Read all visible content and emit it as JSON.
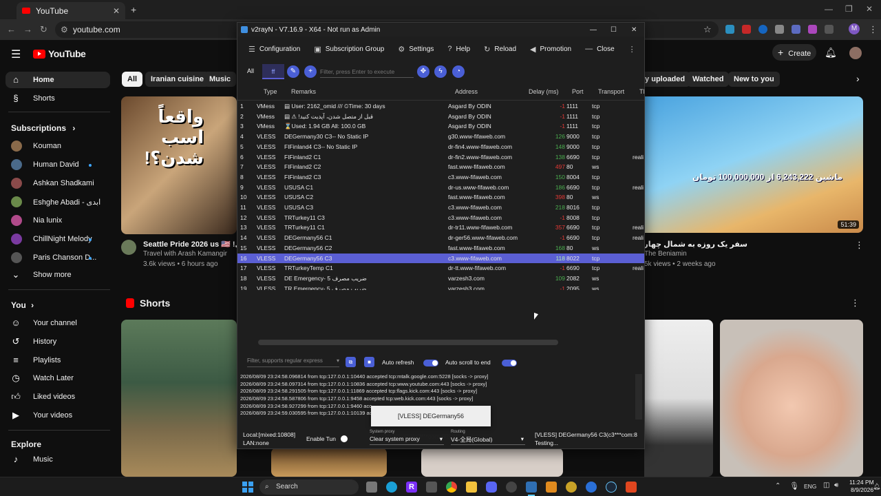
{
  "browser": {
    "tab_title": "YouTube",
    "url": "youtube.com",
    "profile_initial": "M"
  },
  "youtube": {
    "logo": "YouTube",
    "create_label": "Create",
    "nav": [
      {
        "label": "Home",
        "icon": "home-icon"
      },
      {
        "label": "Shorts",
        "icon": "shorts-icon"
      }
    ],
    "subscriptions_title": "Subscriptions",
    "subscriptions": [
      {
        "name": "Kouman",
        "dot": false,
        "color": "#8a6a4a"
      },
      {
        "name": "Human David",
        "dot": true,
        "color": "#4a6a8a"
      },
      {
        "name": "Ashkan Shadkami",
        "dot": false,
        "color": "#8a4a4a"
      },
      {
        "name": "Eshghe Abadi - ابدی",
        "dot": false,
        "color": "#6a8a4a"
      },
      {
        "name": "Nia lunix",
        "dot": false,
        "color": "#b04a8a"
      },
      {
        "name": "ChillNight Melody",
        "dot": true,
        "color": "#7a3aa0"
      },
      {
        "name": "Paris Chanson D...",
        "dot": true,
        "color": "#555555"
      }
    ],
    "show_more": "Show more",
    "you_title": "You",
    "you_items": [
      {
        "label": "Your channel",
        "icon": "channel-icon"
      },
      {
        "label": "History",
        "icon": "history-icon"
      },
      {
        "label": "Playlists",
        "icon": "playlists-icon"
      },
      {
        "label": "Watch Later",
        "icon": "watch-later-icon"
      },
      {
        "label": "Liked videos",
        "icon": "like-icon"
      },
      {
        "label": "Your videos",
        "icon": "your-videos-icon"
      }
    ],
    "explore_title": "Explore",
    "explore_items": [
      {
        "label": "Music",
        "icon": "music-icon"
      }
    ],
    "chips_left": [
      "All",
      "Iranian cuisine",
      "Music"
    ],
    "chips_right": [
      "ly uploaded",
      "Watched",
      "New to you"
    ],
    "videos": [
      {
        "title": "Seattle Pride 2026 us 🇺🇸 !بیتی",
        "channel": "Travel with Arash Kamangir",
        "meta": "3.6k views • 6 hours ago",
        "thumb_text": "واقعاً اسب شدن؟!"
      },
      {
        "title": "سفر یک روزه به شمال چهارتایی 😭",
        "channel": "The Beniamin",
        "meta": "5k views • 2 weeks ago",
        "duration": "51:39",
        "thumb_text": "ماشین 6,243,222 از 100,000,000 تومان"
      }
    ],
    "shorts_title": "Shorts"
  },
  "v2rayn": {
    "title": "v2rayN - V7.16.9 - X64 - Not run as Admin",
    "menu": [
      {
        "label": "Configuration",
        "icon": "menu-icon"
      },
      {
        "label": "Subscription Group",
        "icon": "subscription-icon"
      },
      {
        "label": "Settings",
        "icon": "gear-icon"
      },
      {
        "label": "Help",
        "icon": "help-icon"
      },
      {
        "label": "Reload",
        "icon": "reload-icon"
      },
      {
        "label": "Promotion",
        "icon": "promotion-icon"
      },
      {
        "label": "Close",
        "icon": "minus-icon"
      }
    ],
    "filter_all": "All",
    "filter_ff": "ff",
    "filter_placeholder": "Filter, press Enter to execute",
    "columns": {
      "type": "Type",
      "remarks": "Remarks",
      "address": "Address",
      "delay": "Delay (ms)",
      "port": "Port",
      "transport": "Transport",
      "tls": "TL"
    },
    "rows": [
      {
        "n": "1",
        "type": "VMess",
        "remarks": "▤ User: 2162_omid /// ⏲Time: 30 days",
        "address": "Asgard By ODIN",
        "delay": "-1",
        "port": "1111",
        "transport": "tcp",
        "tls": ""
      },
      {
        "n": "2",
        "type": "VMess",
        "remarks": "▤ ⚠ !قبل از متصل شدن، آپدیت کنید",
        "address": "Asgard By ODIN",
        "delay": "-1",
        "port": "1111",
        "transport": "tcp",
        "tls": ""
      },
      {
        "n": "3",
        "type": "VMess",
        "remarks": "⌛Used: 1.94 GB  All: 100.0 GB",
        "address": "Asgard By ODIN",
        "delay": "-1",
        "port": "1111",
        "transport": "tcp",
        "tls": ""
      },
      {
        "n": "4",
        "type": "VLESS",
        "remarks": "DEGermany30 C3-- No Static IP",
        "address": "g30.www-fifaweb.com",
        "delay": "126",
        "port": "9000",
        "transport": "tcp",
        "tls": ""
      },
      {
        "n": "5",
        "type": "VLESS",
        "remarks": "FIFinland4 C3-- No Static IP",
        "address": "dr-fin4.www-fifaweb.com",
        "delay": "148",
        "port": "9000",
        "transport": "tcp",
        "tls": ""
      },
      {
        "n": "6",
        "type": "VLESS",
        "remarks": "FIFinland2 C1",
        "address": "dr-fin2.www-fifaweb.com",
        "delay": "138",
        "port": "6690",
        "transport": "tcp",
        "tls": "reali"
      },
      {
        "n": "7",
        "type": "VLESS",
        "remarks": "FIFinland2 C2",
        "address": "fast.www-fifaweb.com",
        "delay": "497",
        "port": "80",
        "transport": "ws",
        "tls": ""
      },
      {
        "n": "8",
        "type": "VLESS",
        "remarks": "FIFinland2 C3",
        "address": "c3.www-fifaweb.com",
        "delay": "150",
        "port": "8004",
        "transport": "tcp",
        "tls": ""
      },
      {
        "n": "9",
        "type": "VLESS",
        "remarks": "USUSA C1",
        "address": "dr-us.www-fifaweb.com",
        "delay": "186",
        "port": "6690",
        "transport": "tcp",
        "tls": "reali"
      },
      {
        "n": "10",
        "type": "VLESS",
        "remarks": "USUSA C2",
        "address": "fast.www-fifaweb.com",
        "delay": "398",
        "port": "80",
        "transport": "ws",
        "tls": ""
      },
      {
        "n": "11",
        "type": "VLESS",
        "remarks": "USUSA C3",
        "address": "c3.www-fifaweb.com",
        "delay": "218",
        "port": "8016",
        "transport": "tcp",
        "tls": ""
      },
      {
        "n": "12",
        "type": "VLESS",
        "remarks": "TRTurkey11 C3",
        "address": "c3.www-fifaweb.com",
        "delay": "-1",
        "port": "8008",
        "transport": "tcp",
        "tls": ""
      },
      {
        "n": "13",
        "type": "VLESS",
        "remarks": "TRTurkey11 C1",
        "address": "dr-tr11.www-fifaweb.com",
        "delay": "357",
        "port": "6690",
        "transport": "tcp",
        "tls": "reali"
      },
      {
        "n": "14",
        "type": "VLESS",
        "remarks": "DEGermany56 C1",
        "address": "dr-ger56.www-fifaweb.com",
        "delay": "-1",
        "port": "6690",
        "transport": "tcp",
        "tls": "reali"
      },
      {
        "n": "15",
        "type": "VLESS",
        "remarks": "DEGermany56 C2",
        "address": "fast.www-fifaweb.com",
        "delay": "168",
        "port": "80",
        "transport": "ws",
        "tls": ""
      },
      {
        "n": "16",
        "type": "VLESS",
        "remarks": "DEGermany56 C3",
        "address": "c3.www-fifaweb.com",
        "delay": "118",
        "port": "8022",
        "transport": "tcp",
        "tls": "",
        "selected": true
      },
      {
        "n": "17",
        "type": "VLESS",
        "remarks": "TRTurkeyTemp C1",
        "address": "dr-tt.www-fifaweb.com",
        "delay": "-1",
        "port": "6690",
        "transport": "tcp",
        "tls": "reali"
      },
      {
        "n": "18",
        "type": "VLESS",
        "remarks": "DE Emergency- 5 ضریب مصرف",
        "address": "varzesh3.com",
        "delay": "109",
        "port": "2082",
        "transport": "ws",
        "tls": ""
      },
      {
        "n": "19",
        "type": "VLESS",
        "remarks": "TR Emergency- 5 ضریب مصرف",
        "address": "varzesh3.com",
        "delay": "-1",
        "port": "2095",
        "transport": "ws",
        "tls": ""
      }
    ],
    "log_filter_placeholder": "Filter, supports regular express",
    "auto_refresh": "Auto refresh",
    "auto_scroll": "Auto scroll to end",
    "log_lines": [
      "2026/08/09 23:24:58.096814 from tcp:127.0.0.1:10440 accepted tcp:mtalk.google.com:5228 [socks -> proxy]",
      "2026/08/09 23:24:58.097314 from tcp:127.0.0.1:10836 accepted tcp:www.youtube.com:443 [socks -> proxy]",
      "2026/08/09 23:24:58.291505 from tcp:127.0.0.1:11869 accepted tcp:flags.kick.com:443 [socks -> proxy]",
      "2026/08/09 23:24:58.587806 from tcp:127.0.0.1:9458 accepted tcp:web.kick.com:443 [socks -> proxy]",
      "2026/08/09 23:24:58.927299 from tcp:127.0.0.1:9460 acc",
      "2026/08/09 23:24:59.030595 from tcp:127.0.0.1:10139 acc"
    ],
    "tooltip": "[VLESS] DEGermany56 C3(c3***com:8022)",
    "status": {
      "local": "Local:[mixed:10808]",
      "lan": "LAN:none",
      "enable_tun": "Enable Tun",
      "system_proxy_label": "System proxy",
      "system_proxy_value": "Clear system proxy",
      "routing_label": "Routing",
      "routing_value": "V4-全局(Global)",
      "server": "[VLESS] DEGermany56 C3(c3***com:8",
      "testing": "Testing..."
    }
  },
  "taskbar": {
    "search": "Search",
    "lang": "ENG",
    "time": "11:24 PM",
    "date": "8/9/2026"
  }
}
